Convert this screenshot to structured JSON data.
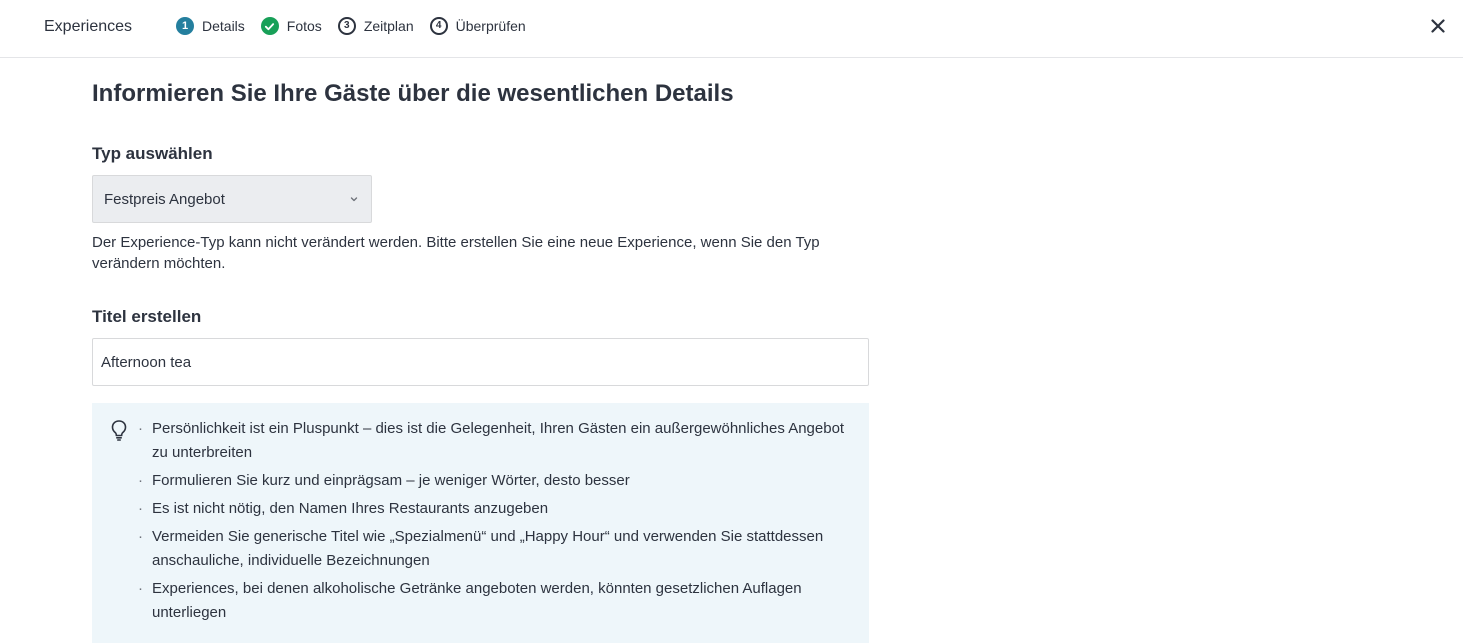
{
  "header": {
    "app_title": "Experiences",
    "steps": [
      {
        "number": "1",
        "label": "Details",
        "state": "active"
      },
      {
        "number": "",
        "label": "Fotos",
        "state": "done"
      },
      {
        "number": "3",
        "label": "Zeitplan",
        "state": "todo"
      },
      {
        "number": "4",
        "label": "Überprüfen",
        "state": "todo"
      }
    ],
    "close_icon": "close-icon"
  },
  "colors": {
    "accent": "#247f9e",
    "done": "#18a058",
    "tips_background": "#eef6fa"
  },
  "main": {
    "title": "Informieren Sie Ihre Gäste über die wesentlichen Details",
    "type_section": {
      "label": "Typ auswählen",
      "selected_value": "Festpreis Angebot",
      "helper_text": "Der Experience-Typ kann nicht verändert werden. Bitte erstellen Sie eine neue Experience, wenn Sie den Typ verändern möchten."
    },
    "title_section": {
      "label": "Titel erstellen",
      "value": "Afternoon tea"
    },
    "tips": {
      "icon": "lightbulb-icon",
      "items": [
        "Persönlichkeit ist ein Pluspunkt – dies ist die Gelegenheit, Ihren Gästen ein außergewöhnliches Angebot zu unterbreiten",
        "Formulieren Sie kurz und einprägsam – je weniger Wörter, desto besser",
        "Es ist nicht nötig, den Namen Ihres Restaurants anzugeben",
        "Vermeiden Sie generische Titel wie „Spezialmenü“ und „Happy Hour“ und verwenden Sie stattdessen anschauliche, individuelle Bezeichnungen",
        "Experiences, bei denen alkoholische Getränke angeboten werden, könnten gesetzlichen Auflagen unterliegen"
      ]
    }
  }
}
